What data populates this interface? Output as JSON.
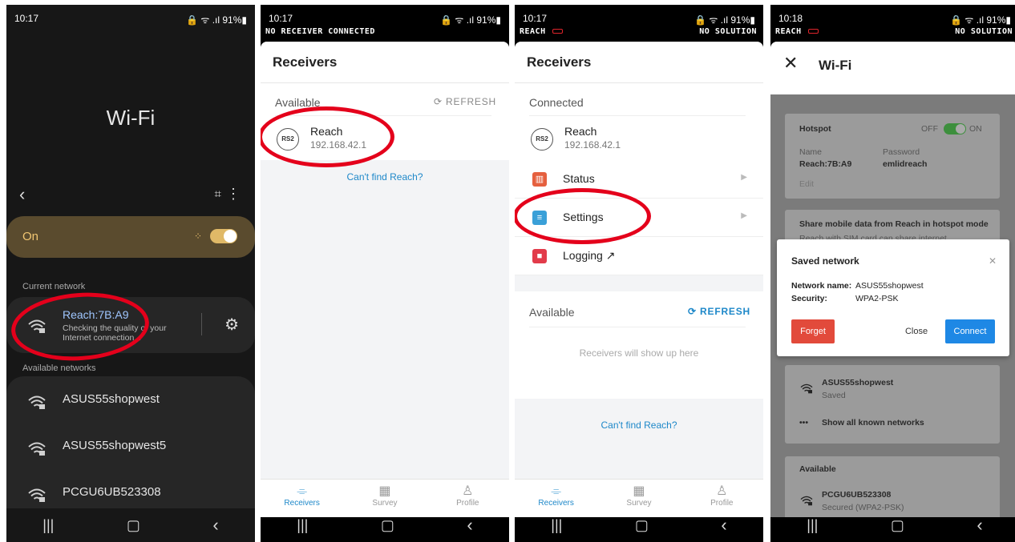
{
  "phone1": {
    "time": "10:17",
    "status_icons": "🔒 ᯤ .ıl 91%▮",
    "title": "Wi-Fi",
    "on_label": "On",
    "current_network_header": "Current network",
    "current_network": {
      "name": "Reach:7B:A9",
      "status": "Checking the quality of your Internet connection..."
    },
    "available_header": "Available networks",
    "available": [
      {
        "name": "ASUS55shopwest"
      },
      {
        "name": "ASUS55shopwest5"
      },
      {
        "name": "PCGU6UB523308"
      }
    ]
  },
  "phone2": {
    "time": "10:17",
    "status_icons": "🔒 ᯤ .ıl 91%▮",
    "banner": "NO RECEIVER CONNECTED",
    "header": "Receivers",
    "available_label": "Available",
    "refresh_label": "REFRESH",
    "receiver": {
      "badge": "RS2",
      "name": "Reach",
      "ip": "192.168.42.1"
    },
    "cant_find": "Can't find Reach?",
    "tabs": [
      "Receivers",
      "Survey",
      "Profile"
    ]
  },
  "phone3": {
    "time": "10:17",
    "status_icons": "🔒 ᯤ .ıl 91%▮",
    "banner_left": "REACH",
    "banner_right": "NO SOLUTION",
    "header": "Receivers",
    "connected_label": "Connected",
    "receiver": {
      "badge": "RS2",
      "name": "Reach",
      "ip": "192.168.42.1"
    },
    "menu": [
      {
        "label": "Status",
        "icon": "status-chart-icon",
        "color": "#e5603f"
      },
      {
        "label": "Settings",
        "icon": "settings-sliders-icon",
        "color": "#3aa0d8"
      },
      {
        "label": "Logging ↗",
        "icon": "logging-record-icon",
        "color": "#e23b4a"
      }
    ],
    "available_label": "Available",
    "refresh_label": "REFRESH",
    "empty_text": "Receivers will show up here",
    "cant_find": "Can't find Reach?",
    "tabs": [
      "Receivers",
      "Survey",
      "Profile"
    ]
  },
  "phone4": {
    "time": "10:18",
    "status_icons": "🔒 ᯤ .ıl 91%▮",
    "banner_left": "REACH",
    "banner_right": "NO SOLUTION",
    "title": "Wi-Fi",
    "hotspot": {
      "label": "Hotspot",
      "off": "OFF",
      "on": "ON",
      "name_label": "Name",
      "name": "Reach:7B:A9",
      "password_label": "Password",
      "password": "emlidreach",
      "edit": "Edit"
    },
    "share": {
      "title": "Share mobile data from Reach in hotspot mode",
      "sub": "Reach with SIM card can share internet"
    },
    "dialog": {
      "title": "Saved network",
      "network_name_label": "Network name:",
      "network_name": "ASUS55shopwest",
      "security_label": "Security:",
      "security": "WPA2-PSK",
      "forget": "Forget",
      "close": "Close",
      "connect": "Connect"
    },
    "saved_network": {
      "name": "ASUS55shopwest",
      "status": "Saved"
    },
    "show_all": "Show all known networks",
    "available_label": "Available",
    "available_network": {
      "name": "PCGU6UB523308",
      "status": "Secured (WPA2-PSK)"
    }
  }
}
